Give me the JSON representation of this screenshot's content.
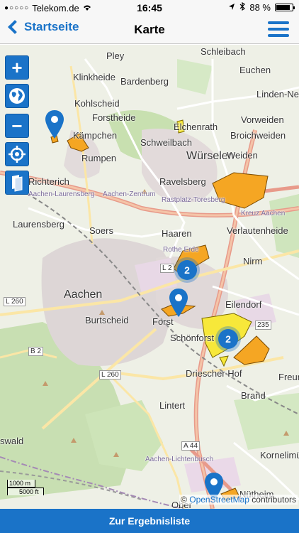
{
  "status": {
    "carrier": "Telekom.de",
    "time": "16:45",
    "battery": "88 %",
    "battery_level": 0.88
  },
  "nav": {
    "back_label": "Startseite",
    "title": "Karte"
  },
  "map": {
    "labels": {
      "schleibach": "Schleibach",
      "euchen": "Euchen",
      "pley": "Pley",
      "klinkheide": "Klinkheide",
      "bardenberg": "Bardenberg",
      "linden_neusen": "Linden-Neus",
      "kohlscheid": "Kohlscheid",
      "forstheide": "Forstheide",
      "elchenrath": "Elchenrath",
      "vorweiden": "Vorweiden",
      "kaempchen": "Kämpchen",
      "schweilbach": "Schweilbach",
      "broichweiden": "Broichweiden",
      "rumpen": "Rumpen",
      "wuerselen": "Würselen",
      "weiden": "Weiden",
      "richterich": "Richterich",
      "ravelsberg": "Ravelsberg",
      "laurensberg": "Laurensberg",
      "soers": "Soers",
      "verlautenheide": "Verlautenheide",
      "haaren": "Haaren",
      "nirm": "Nirm",
      "aachen": "Aachen",
      "eilendorf": "Eilendorf",
      "forst": "Forst",
      "schoenforst": "Schönforst",
      "burtscheid": "Burtscheid",
      "driescher_hof": "Driescher Hof",
      "freund": "Freun",
      "brand": "Brand",
      "lintert": "Lintert",
      "kornelimuenster": "Kornelimün",
      "oswald": "swald",
      "nuetheim": "Nütheim",
      "oberforstbach": "Ober",
      "road_l260_a": "L 260",
      "road_l260_b": "L 260",
      "road_b2": "B 2",
      "road_l2": "L 2",
      "road_235": "235",
      "road_a44": "A 44",
      "small_aachen_zentrum": "Aachen-Zentrum",
      "small_rastplatz": "Rastplatz-Toresberg",
      "small_kreuz_aachen": "Kreuz Aachen",
      "small_aachen_laurensberg": "Aachen-Laurensberg",
      "small_rothe_erde": "Rothe Erde",
      "small_lichtenbusch": "Aachen-Lichtenbusch"
    },
    "clusters": [
      "2",
      "2"
    ],
    "scale_metric": "1000 m",
    "scale_imperial": "5000 ft",
    "attribution_copy": "©",
    "attribution_osm": "OpenStreetMap",
    "attribution_rest": " contributors"
  },
  "controls": {
    "zoom_in": "+",
    "zoom_out": "−"
  },
  "bottom": {
    "button_label": "Zur Ergebnisliste"
  },
  "colors": {
    "accent": "#1a73c8",
    "polygon_orange": "#f5a623",
    "polygon_yellow": "#f7e83a"
  }
}
